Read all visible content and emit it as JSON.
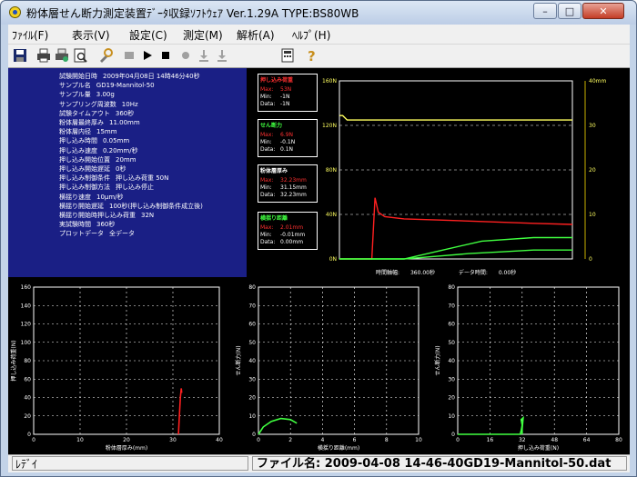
{
  "window": {
    "title": "粉体層せん断力測定装置ﾃﾞｰﾀ収録ｿﾌﾄｳｪｱ Ver.1.29A TYPE:BS80WB",
    "buttons": {
      "minimize": "–",
      "maximize": "□",
      "close": "✕"
    }
  },
  "menu": [
    "ﾌｧｲﾙ(F)",
    "表示(V)",
    "設定(C)",
    "測定(M)",
    "解析(A)",
    "ﾍﾙﾌﾟ(H)"
  ],
  "toolbar": [
    "save-icon",
    "print-icon",
    "print-setup-icon",
    "print-preview-icon",
    "settings-icon",
    "stop-gray-icon",
    "play-icon",
    "stop-icon",
    "record-icon",
    "download-icon",
    "download-alt-icon",
    "calculator-icon",
    "help-icon"
  ],
  "info": [
    {
      "label": "試験開始日時",
      "value": "2009年04月08日 14時46分40秒"
    },
    {
      "label": "サンプル名",
      "value": "GD19-Mannitol-50"
    },
    {
      "label": "サンプル量",
      "value": "3.00g"
    },
    {
      "label": "サンプリング周波数",
      "value": "10Hz"
    },
    {
      "label": "試験タイムアウト",
      "value": "360秒"
    },
    {
      "label": "粉体層最終厚み",
      "value": "11.00mm"
    },
    {
      "label": "粉体層内径",
      "value": "15mm"
    },
    {
      "label": "押し込み時間",
      "value": "0.05mm"
    },
    {
      "label": "押し込み速度",
      "value": "0.20mm/秒"
    },
    {
      "label": "押し込み開始位置",
      "value": "20mm"
    },
    {
      "label": "押し込み開始遅延",
      "value": "0秒"
    },
    {
      "label": "押し込み制御条件",
      "value": "押し込み荷重 50N"
    },
    {
      "label": "押し込み制御方法",
      "value": "押し込み停止"
    },
    {
      "label": "横揺り速度",
      "value": "10μm/秒"
    },
    {
      "label": "横揺り開始遅延",
      "value": "100秒(押し込み制御条件成立後)"
    },
    {
      "label": "横揺り開始時押し込み荷重",
      "value": "32N"
    },
    {
      "label": "実試験時間",
      "value": "360秒"
    },
    {
      "label": "プロットデータ",
      "value": "全データ"
    }
  ],
  "readouts": [
    {
      "title": "押し込み荷重",
      "title_color": "#ff3030",
      "max": "53N",
      "min": "-1N",
      "data": "-1N"
    },
    {
      "title": "せん断力",
      "title_color": "#40ff40",
      "max": "6.9N",
      "min": "-0.1N",
      "data": "0.1N"
    },
    {
      "title": "粉体層厚み",
      "title_color": "#ffffff",
      "max": "32.23mm",
      "min": "31.15mm",
      "data": "32.23mm"
    },
    {
      "title": "横揺り距離",
      "title_color": "#40ff40",
      "max": "2.01mm",
      "min": "-0.01mm",
      "data": "0.00mm"
    }
  ],
  "readout_labels": {
    "max": "Max:",
    "min": "Min:",
    "data": "Data:"
  },
  "time_readouts": {
    "axis_label": "時間軸幅:",
    "axis_value": "360.00秒",
    "data_label": "データ時間:",
    "data_value": "0.00秒"
  },
  "colors": {
    "force": "#ff2020",
    "shear": "#40ff40",
    "thickness": "#ffff60",
    "distance": "#40ff40",
    "info_bg": "#1a1f85",
    "grid": "#ffffff"
  },
  "chart_data": [
    {
      "type": "line",
      "title": "",
      "y_left": {
        "ticks": [
          "0N",
          "40N",
          "80N",
          "120N",
          "160N"
        ],
        "range": [
          0,
          160
        ]
      },
      "y_right": {
        "ticks": [
          "0",
          "10",
          "20",
          "30",
          "40mm"
        ],
        "range": [
          0,
          40
        ]
      },
      "x": {
        "range": [
          0,
          360
        ]
      },
      "grid": true,
      "series": [
        {
          "points": [
            [
              0,
              0
            ],
            [
              50,
              0
            ],
            [
              55,
              55
            ],
            [
              60,
              42
            ],
            [
              70,
              38
            ],
            [
              100,
              36
            ],
            [
              150,
              35
            ],
            [
              200,
              34
            ],
            [
              250,
              33
            ],
            [
              300,
              32
            ],
            [
              360,
              31
            ]
          ]
        },
        {
          "points": [
            [
              0,
              32.2
            ],
            [
              5,
              32.2
            ],
            [
              12,
              31.2
            ],
            [
              360,
              31.2
            ]
          ]
        },
        {
          "points": [
            [
              0,
              0
            ],
            [
              100,
              0
            ],
            [
              150,
              0.6
            ],
            [
              200,
              1.2
            ],
            [
              250,
              1.6
            ],
            [
              300,
              2.0
            ],
            [
              360,
              2.0
            ]
          ]
        },
        {
          "points": [
            [
              0,
              0
            ],
            [
              100,
              0
            ],
            [
              160,
              1
            ],
            [
              220,
              2
            ],
            [
              300,
              2.4
            ],
            [
              360,
              2.4
            ]
          ]
        }
      ]
    },
    {
      "type": "line",
      "xlabel": "粉体層厚み(mm)",
      "ylabel": "押し込み荷重(N)",
      "x_ticks": [
        "0",
        "10",
        "20",
        "30",
        "40"
      ],
      "xlim": [
        0,
        40
      ],
      "y_ticks": [
        "0",
        "20",
        "40",
        "60",
        "80",
        "100",
        "120",
        "140",
        "160"
      ],
      "ylim": [
        0,
        160
      ],
      "grid": true,
      "series": [
        {
          "points": [
            [
              31.2,
              0
            ],
            [
              31.4,
              20
            ],
            [
              31.6,
              40
            ],
            [
              31.8,
              50
            ],
            [
              31.9,
              45
            ]
          ]
        }
      ]
    },
    {
      "type": "line",
      "xlabel": "横揺り距離(mm)",
      "ylabel": "せん断力(N)",
      "x_ticks": [
        "0",
        "2",
        "4",
        "6",
        "8",
        "10"
      ],
      "xlim": [
        0,
        10
      ],
      "y_ticks": [
        "0",
        "10",
        "20",
        "30",
        "40",
        "50",
        "60",
        "70",
        "80"
      ],
      "ylim": [
        0,
        80
      ],
      "grid": true,
      "series": [
        {
          "points": [
            [
              0,
              0
            ],
            [
              0.3,
              4
            ],
            [
              0.8,
              7
            ],
            [
              1.4,
              8.6
            ],
            [
              2.0,
              8
            ],
            [
              2.4,
              6
            ]
          ]
        }
      ]
    },
    {
      "type": "line",
      "xlabel": "押し込み荷重(N)",
      "ylabel": "せん断力(N)",
      "x_ticks": [
        "0",
        "16",
        "32",
        "48",
        "64",
        "80"
      ],
      "xlim": [
        0,
        80
      ],
      "y_ticks": [
        "0",
        "10",
        "20",
        "30",
        "40",
        "50",
        "60",
        "70",
        "80"
      ],
      "ylim": [
        0,
        80
      ],
      "grid": true,
      "series": [
        {
          "points": [
            [
              0,
              0
            ],
            [
              31,
              0
            ],
            [
              31.5,
              2
            ],
            [
              32,
              5
            ],
            [
              31.5,
              8
            ],
            [
              32.5,
              9
            ],
            [
              32,
              3
            ],
            [
              32,
              0
            ]
          ]
        }
      ]
    }
  ],
  "status": {
    "left": "ﾚﾃﾞｲ",
    "right": "ファイル名: 2009-04-08 14-46-40GD19-Mannitol-50.dat"
  }
}
